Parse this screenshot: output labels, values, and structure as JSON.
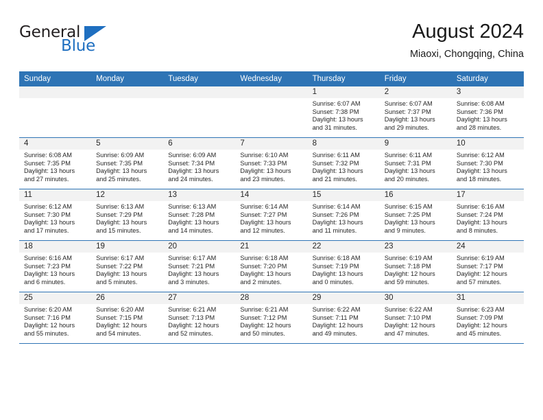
{
  "brand": {
    "name_part1": "General",
    "name_part2": "Blue",
    "triangle_color": "#1f6fc0"
  },
  "header": {
    "title": "August 2024",
    "subtitle": "Miaoxi, Chongqing, China"
  },
  "theme": {
    "header_blue": "#2e74b5",
    "date_band_gray": "#f2f2f2",
    "text_color": "#262626"
  },
  "calendar": {
    "weekday_headers": [
      "Sunday",
      "Monday",
      "Tuesday",
      "Wednesday",
      "Thursday",
      "Friday",
      "Saturday"
    ],
    "weeks": [
      [
        {
          "day": "",
          "empty": true,
          "sunrise": "",
          "sunset": "",
          "daylight_line1": "",
          "daylight_line2": ""
        },
        {
          "day": "",
          "empty": true,
          "sunrise": "",
          "sunset": "",
          "daylight_line1": "",
          "daylight_line2": ""
        },
        {
          "day": "",
          "empty": true,
          "sunrise": "",
          "sunset": "",
          "daylight_line1": "",
          "daylight_line2": ""
        },
        {
          "day": "",
          "empty": true,
          "sunrise": "",
          "sunset": "",
          "daylight_line1": "",
          "daylight_line2": ""
        },
        {
          "day": "1",
          "empty": false,
          "sunrise": "Sunrise: 6:07 AM",
          "sunset": "Sunset: 7:38 PM",
          "daylight_line1": "Daylight: 13 hours",
          "daylight_line2": "and 31 minutes."
        },
        {
          "day": "2",
          "empty": false,
          "sunrise": "Sunrise: 6:07 AM",
          "sunset": "Sunset: 7:37 PM",
          "daylight_line1": "Daylight: 13 hours",
          "daylight_line2": "and 29 minutes."
        },
        {
          "day": "3",
          "empty": false,
          "sunrise": "Sunrise: 6:08 AM",
          "sunset": "Sunset: 7:36 PM",
          "daylight_line1": "Daylight: 13 hours",
          "daylight_line2": "and 28 minutes."
        }
      ],
      [
        {
          "day": "4",
          "empty": false,
          "sunrise": "Sunrise: 6:08 AM",
          "sunset": "Sunset: 7:35 PM",
          "daylight_line1": "Daylight: 13 hours",
          "daylight_line2": "and 27 minutes."
        },
        {
          "day": "5",
          "empty": false,
          "sunrise": "Sunrise: 6:09 AM",
          "sunset": "Sunset: 7:35 PM",
          "daylight_line1": "Daylight: 13 hours",
          "daylight_line2": "and 25 minutes."
        },
        {
          "day": "6",
          "empty": false,
          "sunrise": "Sunrise: 6:09 AM",
          "sunset": "Sunset: 7:34 PM",
          "daylight_line1": "Daylight: 13 hours",
          "daylight_line2": "and 24 minutes."
        },
        {
          "day": "7",
          "empty": false,
          "sunrise": "Sunrise: 6:10 AM",
          "sunset": "Sunset: 7:33 PM",
          "daylight_line1": "Daylight: 13 hours",
          "daylight_line2": "and 23 minutes."
        },
        {
          "day": "8",
          "empty": false,
          "sunrise": "Sunrise: 6:11 AM",
          "sunset": "Sunset: 7:32 PM",
          "daylight_line1": "Daylight: 13 hours",
          "daylight_line2": "and 21 minutes."
        },
        {
          "day": "9",
          "empty": false,
          "sunrise": "Sunrise: 6:11 AM",
          "sunset": "Sunset: 7:31 PM",
          "daylight_line1": "Daylight: 13 hours",
          "daylight_line2": "and 20 minutes."
        },
        {
          "day": "10",
          "empty": false,
          "sunrise": "Sunrise: 6:12 AM",
          "sunset": "Sunset: 7:30 PM",
          "daylight_line1": "Daylight: 13 hours",
          "daylight_line2": "and 18 minutes."
        }
      ],
      [
        {
          "day": "11",
          "empty": false,
          "sunrise": "Sunrise: 6:12 AM",
          "sunset": "Sunset: 7:30 PM",
          "daylight_line1": "Daylight: 13 hours",
          "daylight_line2": "and 17 minutes."
        },
        {
          "day": "12",
          "empty": false,
          "sunrise": "Sunrise: 6:13 AM",
          "sunset": "Sunset: 7:29 PM",
          "daylight_line1": "Daylight: 13 hours",
          "daylight_line2": "and 15 minutes."
        },
        {
          "day": "13",
          "empty": false,
          "sunrise": "Sunrise: 6:13 AM",
          "sunset": "Sunset: 7:28 PM",
          "daylight_line1": "Daylight: 13 hours",
          "daylight_line2": "and 14 minutes."
        },
        {
          "day": "14",
          "empty": false,
          "sunrise": "Sunrise: 6:14 AM",
          "sunset": "Sunset: 7:27 PM",
          "daylight_line1": "Daylight: 13 hours",
          "daylight_line2": "and 12 minutes."
        },
        {
          "day": "15",
          "empty": false,
          "sunrise": "Sunrise: 6:14 AM",
          "sunset": "Sunset: 7:26 PM",
          "daylight_line1": "Daylight: 13 hours",
          "daylight_line2": "and 11 minutes."
        },
        {
          "day": "16",
          "empty": false,
          "sunrise": "Sunrise: 6:15 AM",
          "sunset": "Sunset: 7:25 PM",
          "daylight_line1": "Daylight: 13 hours",
          "daylight_line2": "and 9 minutes."
        },
        {
          "day": "17",
          "empty": false,
          "sunrise": "Sunrise: 6:16 AM",
          "sunset": "Sunset: 7:24 PM",
          "daylight_line1": "Daylight: 13 hours",
          "daylight_line2": "and 8 minutes."
        }
      ],
      [
        {
          "day": "18",
          "empty": false,
          "sunrise": "Sunrise: 6:16 AM",
          "sunset": "Sunset: 7:23 PM",
          "daylight_line1": "Daylight: 13 hours",
          "daylight_line2": "and 6 minutes."
        },
        {
          "day": "19",
          "empty": false,
          "sunrise": "Sunrise: 6:17 AM",
          "sunset": "Sunset: 7:22 PM",
          "daylight_line1": "Daylight: 13 hours",
          "daylight_line2": "and 5 minutes."
        },
        {
          "day": "20",
          "empty": false,
          "sunrise": "Sunrise: 6:17 AM",
          "sunset": "Sunset: 7:21 PM",
          "daylight_line1": "Daylight: 13 hours",
          "daylight_line2": "and 3 minutes."
        },
        {
          "day": "21",
          "empty": false,
          "sunrise": "Sunrise: 6:18 AM",
          "sunset": "Sunset: 7:20 PM",
          "daylight_line1": "Daylight: 13 hours",
          "daylight_line2": "and 2 minutes."
        },
        {
          "day": "22",
          "empty": false,
          "sunrise": "Sunrise: 6:18 AM",
          "sunset": "Sunset: 7:19 PM",
          "daylight_line1": "Daylight: 13 hours",
          "daylight_line2": "and 0 minutes."
        },
        {
          "day": "23",
          "empty": false,
          "sunrise": "Sunrise: 6:19 AM",
          "sunset": "Sunset: 7:18 PM",
          "daylight_line1": "Daylight: 12 hours",
          "daylight_line2": "and 59 minutes."
        },
        {
          "day": "24",
          "empty": false,
          "sunrise": "Sunrise: 6:19 AM",
          "sunset": "Sunset: 7:17 PM",
          "daylight_line1": "Daylight: 12 hours",
          "daylight_line2": "and 57 minutes."
        }
      ],
      [
        {
          "day": "25",
          "empty": false,
          "sunrise": "Sunrise: 6:20 AM",
          "sunset": "Sunset: 7:16 PM",
          "daylight_line1": "Daylight: 12 hours",
          "daylight_line2": "and 55 minutes."
        },
        {
          "day": "26",
          "empty": false,
          "sunrise": "Sunrise: 6:20 AM",
          "sunset": "Sunset: 7:15 PM",
          "daylight_line1": "Daylight: 12 hours",
          "daylight_line2": "and 54 minutes."
        },
        {
          "day": "27",
          "empty": false,
          "sunrise": "Sunrise: 6:21 AM",
          "sunset": "Sunset: 7:13 PM",
          "daylight_line1": "Daylight: 12 hours",
          "daylight_line2": "and 52 minutes."
        },
        {
          "day": "28",
          "empty": false,
          "sunrise": "Sunrise: 6:21 AM",
          "sunset": "Sunset: 7:12 PM",
          "daylight_line1": "Daylight: 12 hours",
          "daylight_line2": "and 50 minutes."
        },
        {
          "day": "29",
          "empty": false,
          "sunrise": "Sunrise: 6:22 AM",
          "sunset": "Sunset: 7:11 PM",
          "daylight_line1": "Daylight: 12 hours",
          "daylight_line2": "and 49 minutes."
        },
        {
          "day": "30",
          "empty": false,
          "sunrise": "Sunrise: 6:22 AM",
          "sunset": "Sunset: 7:10 PM",
          "daylight_line1": "Daylight: 12 hours",
          "daylight_line2": "and 47 minutes."
        },
        {
          "day": "31",
          "empty": false,
          "sunrise": "Sunrise: 6:23 AM",
          "sunset": "Sunset: 7:09 PM",
          "daylight_line1": "Daylight: 12 hours",
          "daylight_line2": "and 45 minutes."
        }
      ]
    ]
  }
}
